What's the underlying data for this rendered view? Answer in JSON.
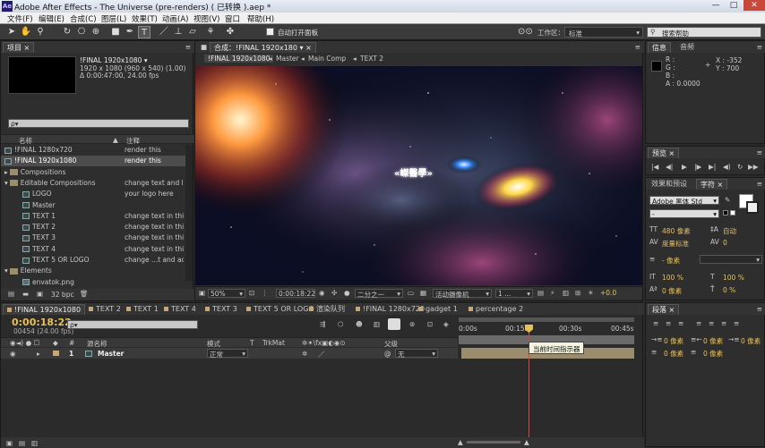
{
  "window": {
    "title": "Adobe After Effects - The Universe (pre-renders) ( 已转换 ).aep *",
    "app_icon": "Ae",
    "minimize": "—",
    "maximize": "□",
    "close": "✕"
  },
  "menu": [
    "文件(F)",
    "编辑(E)",
    "合成(C)",
    "图层(L)",
    "效果(T)",
    "动画(A)",
    "视图(V)",
    "窗口",
    "帮助(H)"
  ],
  "toolbar": {
    "auto_open_label": "自动打开面板",
    "workspace_label": "工作区：",
    "workspace_value": "标准",
    "search_placeholder": "搜索帮助"
  },
  "project": {
    "tab": "项目",
    "comp_name": "!FINAL 1920x1080 ▾",
    "comp_size": "1920 x 1080  (960 x 540) (1.00)",
    "comp_duration": "Δ 0:00:47:00, 24.00 fps",
    "search_placeholder": "ρ▾",
    "col_name": "名称",
    "col_comment": "注释",
    "bpc": "32 bpc",
    "items": [
      {
        "name": "!FINAL 1280x720",
        "comment": "render this",
        "type": "comp",
        "indent": 0
      },
      {
        "name": "!FINAL 1920x1080",
        "comment": "render this",
        "type": "comp",
        "indent": 0
      },
      {
        "name": "Compositions",
        "comment": "",
        "type": "folder",
        "indent": 0
      },
      {
        "name": "Editable Compositions",
        "comment": "change text and logo",
        "type": "folder-open",
        "indent": 0
      },
      {
        "name": "LOGO",
        "comment": "your logo here",
        "type": "comp",
        "indent": 1
      },
      {
        "name": "Master",
        "comment": "",
        "type": "comp",
        "indent": 1
      },
      {
        "name": "TEXT 1",
        "comment": "change text in this c",
        "type": "comp",
        "indent": 1
      },
      {
        "name": "TEXT 2",
        "comment": "change text in this c",
        "type": "comp",
        "indent": 1
      },
      {
        "name": "TEXT 3",
        "comment": "change text in this c",
        "type": "comp",
        "indent": 1
      },
      {
        "name": "TEXT 4",
        "comment": "change text in this c",
        "type": "comp",
        "indent": 1
      },
      {
        "name": "TEXT 5 OR LOGO",
        "comment": "change ...t and adju",
        "type": "comp",
        "indent": 1
      },
      {
        "name": "Elements",
        "comment": "",
        "type": "folder-open",
        "indent": 0
      },
      {
        "name": "envatok.png",
        "comment": "",
        "type": "image",
        "indent": 1
      }
    ]
  },
  "composition": {
    "tab": "合成：!FINAL 1920x180",
    "breadcrumbs": [
      "!FINAL 1920x1080",
      "Master",
      "Main Comp",
      "TEXT 2"
    ],
    "overlay_text": "«嵥醫學»",
    "zoom": "50%",
    "timecode": "0:00:18:22",
    "resolution": "二分之一",
    "camera": "活动摄像机",
    "views": "1 ...",
    "exposure": "+0.0"
  },
  "info": {
    "tab_info": "信息",
    "tab_audio": "音频",
    "r": "R :",
    "g": "G :",
    "b": "B :",
    "a": "A : 0.0000",
    "x": "X : -352",
    "y": "Y : 700"
  },
  "preview": {
    "tab": "预览",
    "controls": [
      "|◀",
      "◀|",
      "▶",
      "|▶",
      "▶|",
      "◀)",
      "↻",
      "▶▶"
    ]
  },
  "character": {
    "tab_effects": "效果和预设",
    "tab_char": "字符",
    "font": "Adobe 黑体 Std",
    "style": "-",
    "size": "480 像素",
    "leading": "自动",
    "tracking": "度量标准",
    "kerning": "0",
    "stroke": "- 像素",
    "scale_v": "100 %",
    "scale_h": "100 %",
    "baseline": "0 像素",
    "tsume": "0 %"
  },
  "paragraph": {
    "tab": "段落",
    "indent_left": "0 像素",
    "indent_right": "0 像素",
    "indent_first": "0 像素",
    "space_before": "0 像素",
    "space_after": "0 像素"
  },
  "timeline": {
    "tabs": [
      "!FINAL 1920x1080",
      "TEXT 2",
      "TEXT 1",
      "TEXT 4",
      "TEXT 3",
      "TEXT 5 OR LOGO",
      "渲染队列",
      "!FINAL 1280x720",
      "gadget 1",
      "percentage 2"
    ],
    "timecode": "0:00:18:22",
    "frames": "00454 (24.00 fps)",
    "search_placeholder": "ρ▾",
    "col_source": "源名称",
    "col_mode": "模式",
    "col_t": "T",
    "col_trkmat": "TrkMat",
    "col_parent": "父级",
    "layer_num": "1",
    "layer_name": "Master",
    "layer_mode": "正常",
    "layer_parent": "无",
    "ruler": [
      "0:00s",
      "00:15s",
      "00:30s",
      "00:45s"
    ],
    "tooltip": "当前时间指示器"
  }
}
